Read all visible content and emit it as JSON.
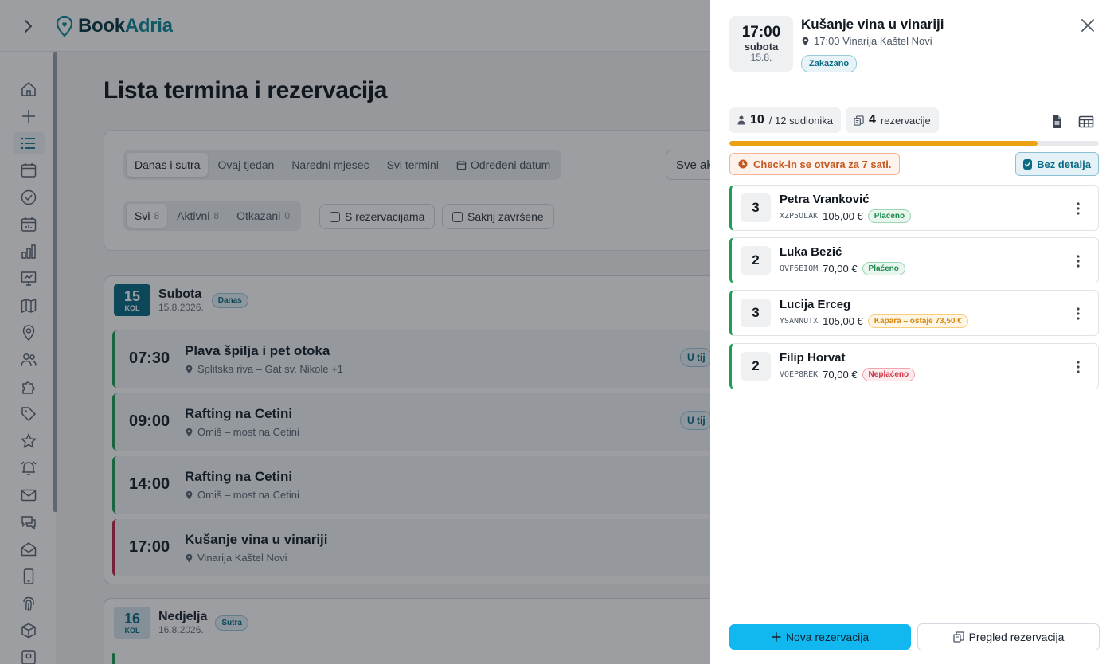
{
  "app": {
    "brand": {
      "part1": "Book",
      "part2": "Adria"
    }
  },
  "sidebar": {
    "icons": [
      "home-icon",
      "plus-icon",
      "list-icon",
      "calendar-icon",
      "check-circle-icon",
      "calendar-stats-icon",
      "bar-chart-icon",
      "presentation-icon",
      "map-icon",
      "location-pin-icon",
      "users-icon",
      "puzzle-icon",
      "tag-icon",
      "star-icon",
      "alarm-icon",
      "mail-icon",
      "chat-icon",
      "mail-open-icon",
      "mobile-icon",
      "fingerprint-icon",
      "box-icon",
      "user-badge-icon"
    ],
    "active_index": 2
  },
  "main": {
    "title": "Lista termina i rezervacija",
    "period_tabs": [
      {
        "label": "Danas i sutra",
        "active": true
      },
      {
        "label": "Ovaj tjedan",
        "active": false
      },
      {
        "label": "Naredni mjesec",
        "active": false
      },
      {
        "label": "Svi termini",
        "active": false
      },
      {
        "label": "Određeni datum",
        "active": false
      }
    ],
    "status_tabs": [
      {
        "label": "Svi",
        "count": "8",
        "active": true
      },
      {
        "label": "Aktivni",
        "count": "8",
        "active": false
      },
      {
        "label": "Otkazani",
        "count": "0",
        "active": false
      }
    ],
    "checkbox_with_reservations": "S rezervacijama",
    "checkbox_hide_finished": "Sakrij završene",
    "search_select": "Sve ak",
    "days": [
      {
        "num": "15",
        "kol": "KOL",
        "name": "Subota",
        "date": "15.8.2026.",
        "badge": "Danas",
        "events": [
          {
            "time": "07:30",
            "title": "Plava špilja i pet otoka",
            "location": "Splitska riva – Gat sv. Nikole +1",
            "status": "U tij"
          },
          {
            "time": "09:00",
            "title": "Rafting na Cetini",
            "location": "Omiš – most na Cetini",
            "status": "U tij"
          },
          {
            "time": "14:00",
            "title": "Rafting na Cetini",
            "location": "Omiš – most na Cetini",
            "status": ""
          },
          {
            "time": "17:00",
            "title": "Kušanje vina u vinariji",
            "location": "Vinarija Kaštel Novi",
            "status": ""
          }
        ]
      },
      {
        "num": "16",
        "kol": "KOL",
        "name": "Nedjelja",
        "date": "16.8.2026.",
        "badge": "Sutra",
        "events": []
      }
    ]
  },
  "drawer": {
    "time": "17:00",
    "weekday": "subota",
    "date": "15.8.",
    "title": "Kušanje vina u vinariji",
    "subtitle": "17:00 Vinarija Kaštel Novi",
    "status": "Zakazano",
    "participants": {
      "current": "10",
      "rest": "/ 12 sudionika"
    },
    "reservations": {
      "count": "4",
      "label": "rezervacije"
    },
    "capacity_fraction": 0.833,
    "checkin_notice": "Check-in se otvara za 7 sati.",
    "toggle_label": "Bez detalja",
    "reservations_list": [
      {
        "people": "3",
        "name": "Petra Vranković",
        "code": "XZP5OLAK",
        "price": "105,00 €",
        "badge": "Plaćeno",
        "badge_type": "paid"
      },
      {
        "people": "2",
        "name": "Luka Bezić",
        "code": "QVF6EIQM",
        "price": "70,00 €",
        "badge": "Plaćeno",
        "badge_type": "paid"
      },
      {
        "people": "3",
        "name": "Lucija Erceg",
        "code": "YSANNUTX",
        "price": "105,00 €",
        "badge": "Kapara – ostaje 73,50 €",
        "badge_type": "deposit"
      },
      {
        "people": "2",
        "name": "Filip Horvat",
        "code": "VOEP8REK",
        "price": "70,00 €",
        "badge": "Neplaćeno",
        "badge_type": "unpaid"
      }
    ],
    "btn_new": "Nova rezervacija",
    "btn_overview": "Pregled rezervacija"
  },
  "colors": {
    "brand": "#0a6b85",
    "primary_button": "#10b8ef",
    "progress": "#eba112",
    "paid": "#1c9e55",
    "deposit": "#d9880f",
    "unpaid": "#d2374a"
  }
}
